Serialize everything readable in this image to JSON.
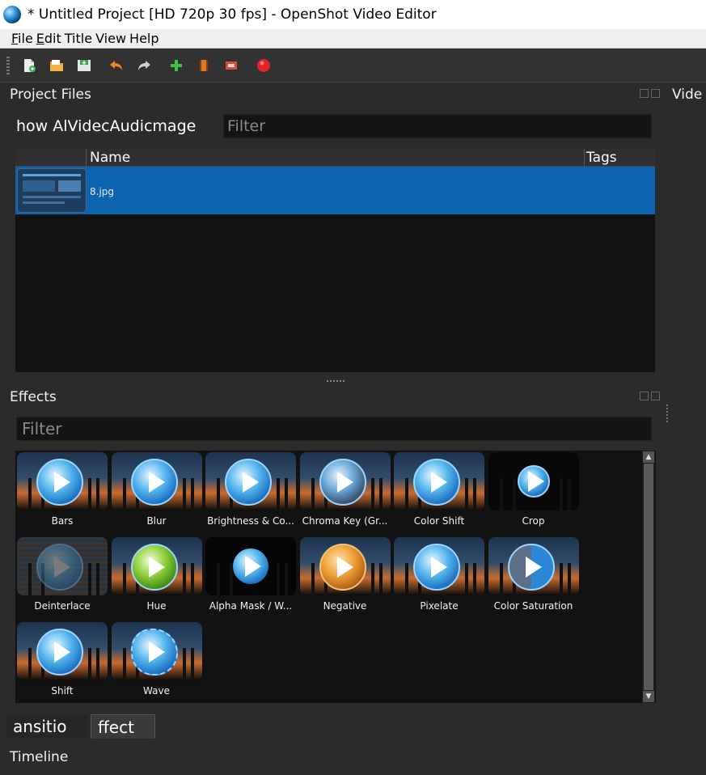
{
  "window": {
    "title": "* Untitled Project [HD 720p 30 fps] - OpenShot Video Editor"
  },
  "menu": [
    {
      "underline": "F",
      "rest": "ile"
    },
    {
      "underline": "E",
      "rest": "dit"
    },
    {
      "underline": "",
      "rest": "Title"
    },
    {
      "underline": "",
      "rest": "View"
    },
    {
      "underline": "",
      "rest": "Help"
    }
  ],
  "toolbar": {
    "buttons": [
      "new-project-icon",
      "open-project-icon",
      "save-project-icon",
      "undo-icon",
      "redo-icon",
      "import-files-icon",
      "profile-icon",
      "fullscreen-icon",
      "export-video-icon"
    ]
  },
  "project_files": {
    "title": "Project Files",
    "filter_tabs": [
      "how Al",
      "Videc",
      "Audic",
      "mage"
    ],
    "filter_placeholder": "Filter",
    "columns": {
      "name": "Name",
      "tags": "Tags"
    },
    "files": [
      {
        "name": "8.jpg"
      }
    ]
  },
  "effects": {
    "title": "Effects",
    "filter_placeholder": "Filter",
    "items": [
      "Bars",
      "Blur",
      "Brightness & Co...",
      "Chroma Key (Gr...",
      "Color Shift",
      "Crop",
      "Deinterlace",
      "Hue",
      "Alpha Mask / W...",
      "Negative",
      "Pixelate",
      "Color Saturation",
      "Shift",
      "Wave"
    ]
  },
  "bottom_tabs": {
    "transitions": "ansitio",
    "effects": "ffect"
  },
  "timeline": {
    "title": "Timeline"
  },
  "video_preview": {
    "title": "Vide"
  },
  "colors": {
    "selection": "#0d63b0",
    "record": "#e3232a",
    "accent": "#56b6ee"
  }
}
